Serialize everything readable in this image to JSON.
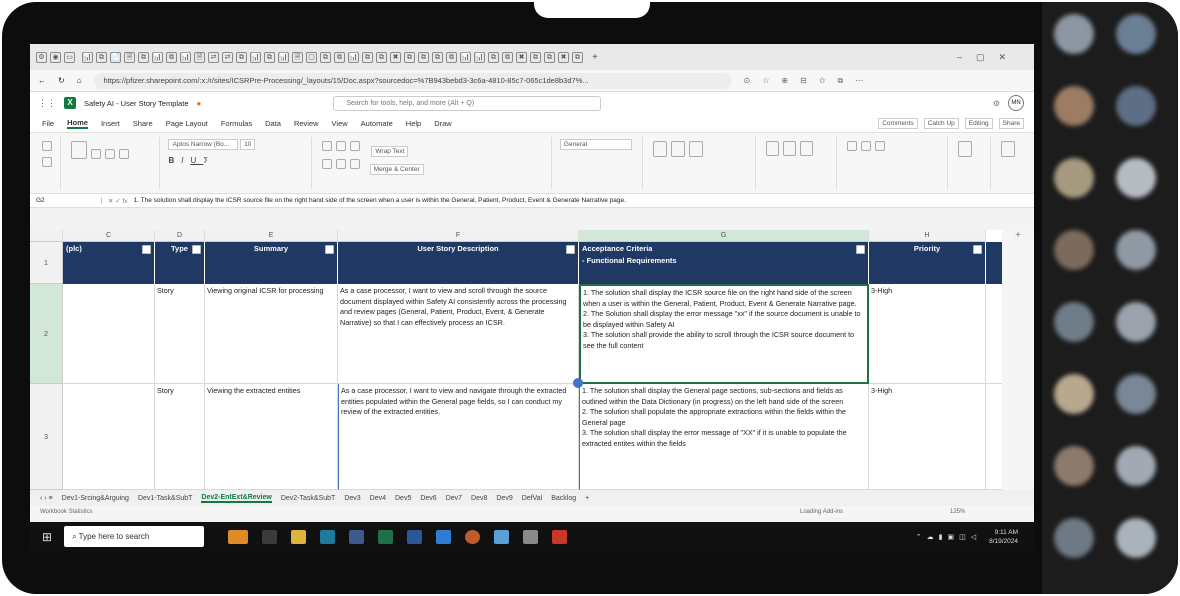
{
  "browser": {
    "tabs": [
      "📊",
      "⧉",
      "📄",
      "🗎",
      "⧉",
      "📊",
      "⧉",
      "📊",
      "🗎",
      "⇄",
      "⇄",
      "⧉",
      "📊",
      "⧉",
      "📊",
      "🗎",
      "▢",
      "⧉",
      "⧉",
      "📊",
      "⧉",
      "⧉",
      "✖",
      "⧉",
      "⧉",
      "⧉",
      "⧉",
      "📊",
      "📊",
      "⧉",
      "⧉",
      "✖",
      "⧉",
      "⧉",
      "✖",
      "⧉"
    ],
    "url": "https://pfizer.sharepoint.com/:x:/r/sites/ICSRPre-Processing/_layouts/15/Doc.aspx?sourcedoc=%7B943bebd3-3c6a-4810-85c7-065c1de8b3d7%..."
  },
  "excel": {
    "file_title": "Safety AI - User Story Template",
    "search_placeholder": "Search for tools, help, and more (Alt + Q)",
    "user_initials": "MN",
    "menu": [
      "File",
      "Home",
      "Insert",
      "Share",
      "Page Layout",
      "Formulas",
      "Data",
      "Review",
      "View",
      "Automate",
      "Help",
      "Draw"
    ],
    "active_menu": "Home",
    "ribbon": {
      "font_name": "Aptos Narrow (Bo...",
      "font_size": "10",
      "wrap_text": "Wrap Text",
      "merge": "Merge & Center",
      "number_format": "General",
      "comments": "Comments",
      "catch_up": "Catch Up",
      "editing": "Editing",
      "share": "Share"
    },
    "name_box": "G2",
    "formula": "1. The solution shall display the ICSR source file on the right hand side of the screen when a user is within the General, Patient, Product, Event & Generate Narrative page.",
    "columns": [
      "C",
      "D",
      "E",
      "F",
      "G",
      "H"
    ],
    "headers": {
      "c": "(plc)",
      "d": "Type",
      "e": "Summary",
      "f": "User Story Description",
      "g1": "Acceptance Criteria",
      "g2": "- Functional Requirements",
      "h": "Priority"
    },
    "rows": [
      {
        "num": "2",
        "type": "Story",
        "summary": "Viewing original ICSR for processing",
        "description": "As a case processor, I want to view and scroll through the source document displayed within Safety AI consistently across the processing and review pages (General, Patient, Product, Event, & Generate Narrative) so that I can effectively process an ICSR.",
        "criteria": "1. The solution shall display the ICSR source file on the right hand side of the screen when a user is within the General, Patient, Product, Event & Generate Narrative page.\n2. The Solution shall display the error message \"xx\" if the source document is unable to be displayed within Safety AI\n3. The solution shall provide the ability to scroll through the ICSR source document to see the full content",
        "priority": "3-High"
      },
      {
        "num": "3",
        "type": "Story",
        "summary": "Viewing the extracted entities",
        "description": "As a case processor, I want to view and navigate through the extracted entities populated within the General page fields, so I can conduct my review of the extracted entities.",
        "criteria": "1. The solution shall display the General page sections, sub-sections and fields as outlined within the Data Dictionary (in progress) on the left hand side of the screen\n2. The solution shall populate the appropriate extractions within the fields within the General page\n3. The solution shall display the error message of \"XX\" if it is unable to populate the extracted entites within the fields",
        "priority": "3-High"
      }
    ],
    "sheets": [
      "Dev1-Srcing&Arguing",
      "Dev1-Task&SubT",
      "Dev2-EntExt&Review",
      "Dev2-Task&SubT",
      "Dev3",
      "Dev4",
      "Dev5",
      "Dev6",
      "Dev7",
      "Dev8",
      "Dev9",
      "DefVal",
      "Backlog"
    ],
    "active_sheet": "Dev2-EntExt&Review",
    "status_left": "Workbook Statistics",
    "status_right": "Loading Add-ins",
    "zoom": "125%"
  },
  "taskbar": {
    "search_placeholder": "Type here to search",
    "time": "9:11 AM",
    "date": "8/19/2024"
  }
}
